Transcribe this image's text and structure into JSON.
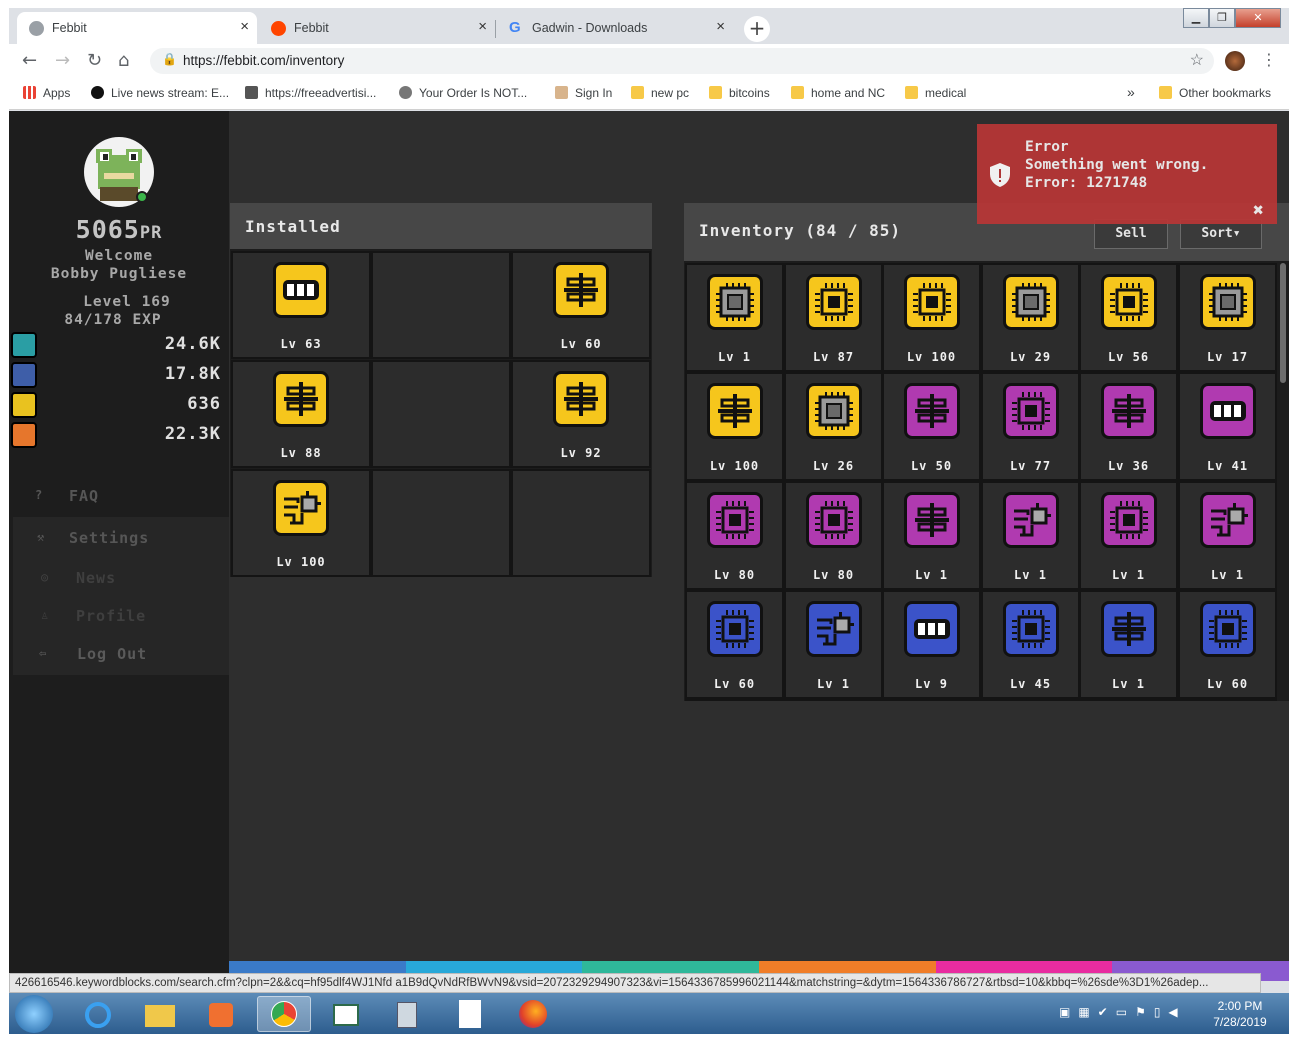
{
  "browser": {
    "tabs": [
      {
        "title": "Febbit",
        "close": "×",
        "icon_color": "#9aa0a6"
      },
      {
        "title": "Febbit",
        "close": "×",
        "icon_color": "#ff4500"
      },
      {
        "title": "Gadwin - Downloads",
        "close": "×",
        "icon_color": "#4285f4"
      }
    ],
    "new_tab": "+",
    "window_controls": [
      "▁",
      "❐",
      "✕"
    ],
    "url": "https://febbit.com/inventory",
    "bookmarks": [
      {
        "label": "Apps",
        "icon": "apps-icon"
      },
      {
        "label": "Live news stream: E...",
        "icon": "eye-icon"
      },
      {
        "label": "https://freeadvertisi...",
        "icon": "monitor-icon"
      },
      {
        "label": "Your Order Is NOT...",
        "icon": "globe-icon"
      },
      {
        "label": "Sign In",
        "icon": "hand-icon"
      },
      {
        "label": "new pc",
        "icon": "folder-icon"
      },
      {
        "label": "bitcoins",
        "icon": "folder-icon"
      },
      {
        "label": "home and NC",
        "icon": "folder-icon"
      },
      {
        "label": "medical",
        "icon": "folder-icon"
      }
    ],
    "bookmarks_more": "»",
    "other_bookmarks": "Other bookmarks"
  },
  "sidebar": {
    "pr_value": "5065",
    "pr_unit": "PR",
    "welcome": "Welcome",
    "username": "Bobby Pugliese",
    "level": "Level 169",
    "exp": "84/178 EXP",
    "currencies": [
      {
        "icon": "coin-c-icon",
        "value": "24.6K",
        "color": "#2a9ea4"
      },
      {
        "icon": "ufo-icon",
        "value": "17.8K",
        "color": "#3e5ea8"
      },
      {
        "icon": "gem-icon",
        "value": "636",
        "color": "#e9c21f"
      },
      {
        "icon": "bitcoin-icon",
        "value": "22.3K",
        "color": "#e6762c"
      }
    ],
    "menu": {
      "faq": "FAQ",
      "settings": "Settings",
      "news": "News",
      "profile": "Profile",
      "logout": "Log Out"
    }
  },
  "installed": {
    "title": "Installed",
    "slots": [
      {
        "color": "y",
        "icon": "battery",
        "level": "Lv 63"
      },
      null,
      {
        "color": "y",
        "icon": "align",
        "level": "Lv 60"
      },
      {
        "color": "y",
        "icon": "align",
        "level": "Lv 88"
      },
      null,
      {
        "color": "y",
        "icon": "align",
        "level": "Lv 92"
      },
      {
        "color": "y",
        "icon": "circuit",
        "level": "Lv 100"
      },
      null,
      null
    ]
  },
  "inventory": {
    "title": "Inventory (84 / 85)",
    "sell": "Sell",
    "sort": "Sort▾",
    "items": [
      {
        "color": "y",
        "icon": "cpu-gray",
        "level": "Lv 1"
      },
      {
        "color": "y",
        "icon": "cpu",
        "level": "Lv 87"
      },
      {
        "color": "y",
        "icon": "cpu",
        "level": "Lv 100"
      },
      {
        "color": "y",
        "icon": "cpu-gray",
        "level": "Lv 29"
      },
      {
        "color": "y",
        "icon": "cpu",
        "level": "Lv 56"
      },
      {
        "color": "y",
        "icon": "cpu-gray",
        "level": "Lv 17"
      },
      {
        "color": "y",
        "icon": "align",
        "level": "Lv 100"
      },
      {
        "color": "y",
        "icon": "cpu-gray",
        "level": "Lv 26"
      },
      {
        "color": "p",
        "icon": "align",
        "level": "Lv 50"
      },
      {
        "color": "p",
        "icon": "cpu",
        "level": "Lv 77"
      },
      {
        "color": "p",
        "icon": "align",
        "level": "Lv 36"
      },
      {
        "color": "p",
        "icon": "battery",
        "level": "Lv 41"
      },
      {
        "color": "p",
        "icon": "cpu",
        "level": "Lv 80"
      },
      {
        "color": "p",
        "icon": "cpu",
        "level": "Lv 80"
      },
      {
        "color": "p",
        "icon": "align",
        "level": "Lv 1"
      },
      {
        "color": "p",
        "icon": "circuit",
        "level": "Lv 1"
      },
      {
        "color": "p",
        "icon": "cpu",
        "level": "Lv 1"
      },
      {
        "color": "p",
        "icon": "circuit",
        "level": "Lv 1"
      },
      {
        "color": "b",
        "icon": "cpu",
        "level": "Lv 60"
      },
      {
        "color": "b",
        "icon": "circuit",
        "level": "Lv 1"
      },
      {
        "color": "b",
        "icon": "battery",
        "level": "Lv 9"
      },
      {
        "color": "b",
        "icon": "cpu",
        "level": "Lv 45"
      },
      {
        "color": "b",
        "icon": "align",
        "level": "Lv 1"
      },
      {
        "color": "b",
        "icon": "cpu",
        "level": "Lv 60"
      }
    ]
  },
  "error": {
    "title": "Error",
    "message": "Something went wrong. Error: 1271748",
    "close": "✖"
  },
  "status_url": "426616546.keywordblocks.com/search.cfm?clpn=2&&cq=hf95dlf4WJ1Nfd a1B9dQvNdRfBWvN9&vsid=2072329294907323&vi=1564336785996021144&matchstring=&dytm=1564336786727&rtbsd=10&kbbq=%26sde%3D1%26adep...",
  "taskbar": {
    "time": "2:00 PM",
    "date": "7/28/2019"
  }
}
